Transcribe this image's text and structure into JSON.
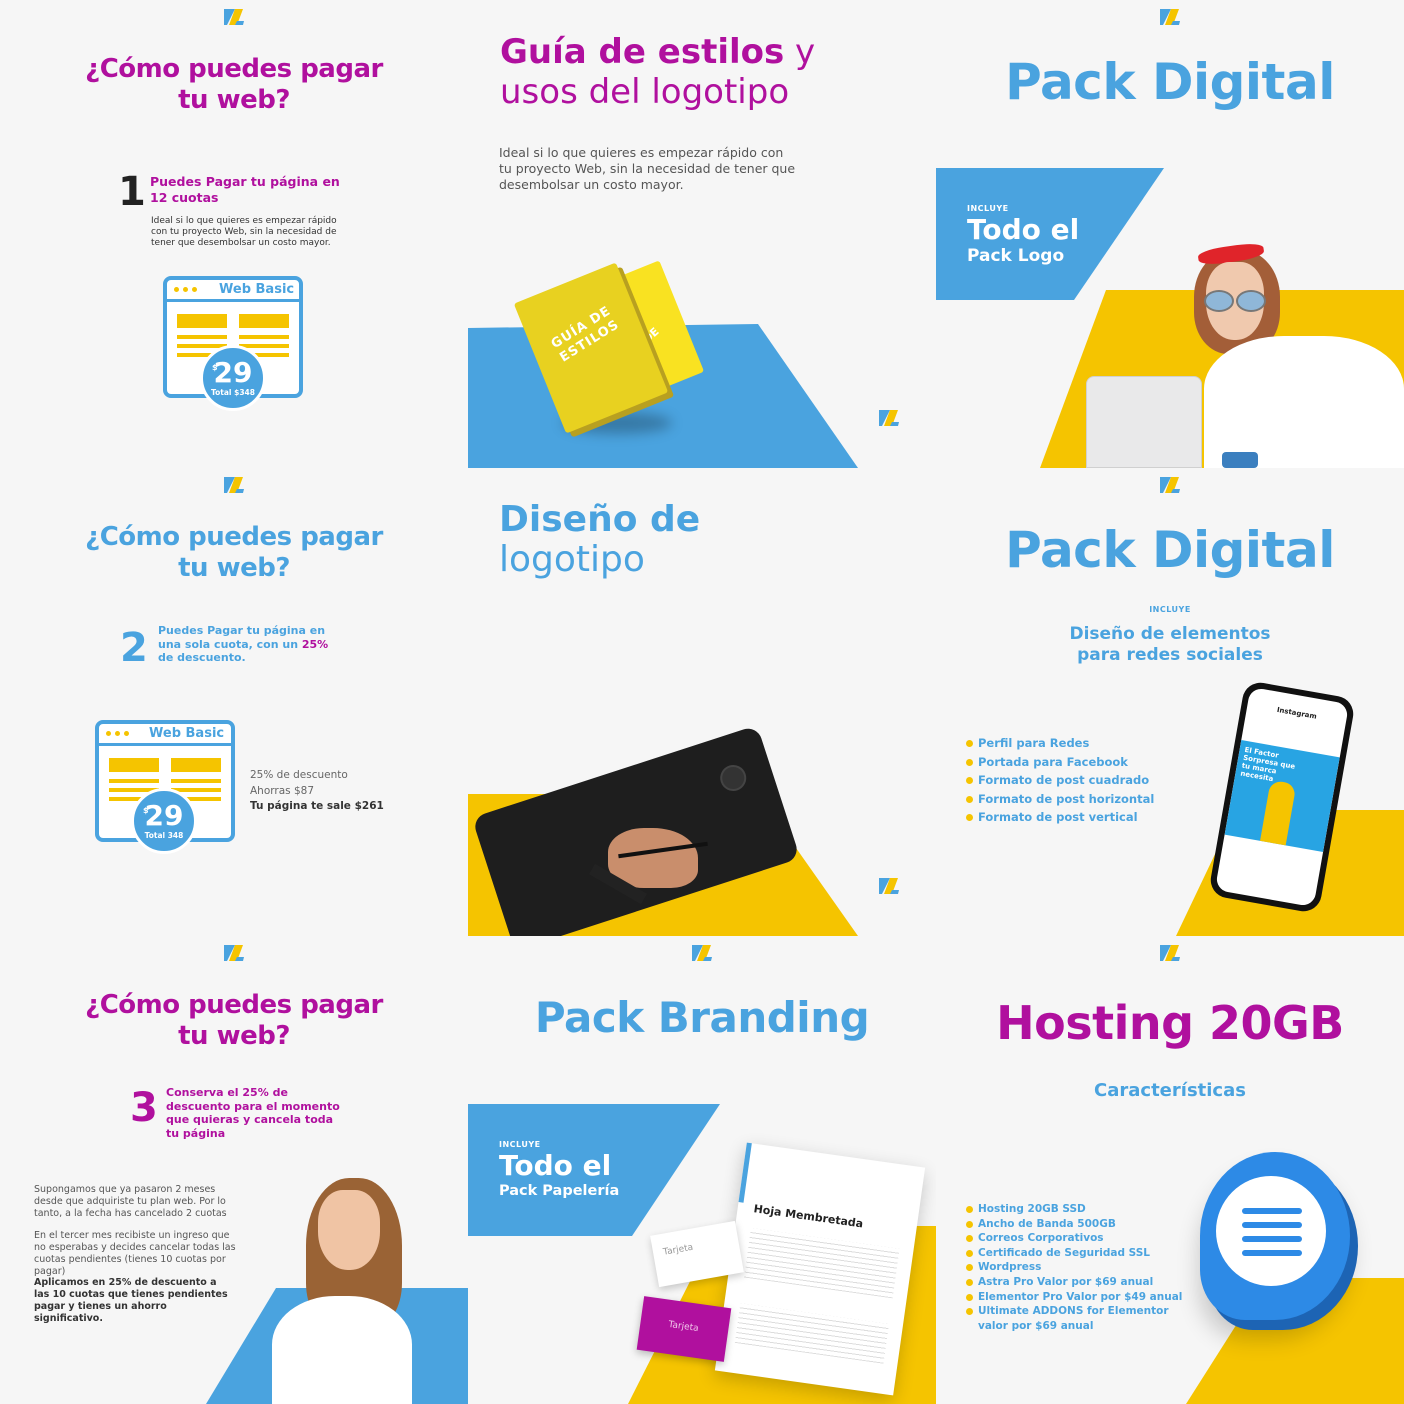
{
  "colors": {
    "magenta": "#b0109e",
    "blue": "#4aa3df",
    "yellow": "#f5c400",
    "bg": "#f6f6f6"
  },
  "logo_icon": "zl-logo-icon",
  "tile1": {
    "title": "¿Cómo puedes pagar tu web?",
    "step_number": "1",
    "step_text": "Puedes Pagar tu página en 12 cuotas",
    "description": "Ideal si lo que quieres es empezar rápido con tu proyecto Web, sin la necesidad de tener que desembolsar un costo mayor.",
    "card_title": "Web Basic",
    "price_currency": "$",
    "price": "29",
    "price_total": "Total $348"
  },
  "tile2": {
    "title_bold": "Guía de estilos",
    "title_rest_1": " y",
    "title_line2": "usos del logotipo",
    "description": "Ideal si lo que quieres es empezar rápido con tu proyecto Web, sin la necesidad de tener que desembolsar un costo mayor.",
    "book_text": "GUÍA DE ESTILOS",
    "book_back_text": "DE"
  },
  "tile3": {
    "title": "Pack Digital",
    "includes_label": "INCLUYE",
    "includes_title": "Todo el",
    "includes_sub": "Pack Logo"
  },
  "tile4": {
    "title": "¿Cómo puedes pagar tu web?",
    "step_number": "2",
    "step_text_a": "Puedes Pagar tu página en una sola cuota, con un ",
    "step_text_bold": "25%",
    "step_text_b": " de descuento.",
    "card_title": "Web Basic",
    "price_currency": "$",
    "price": "29",
    "price_total": "Total 348",
    "discount_line1": "25% de descuento",
    "discount_line2": "Ahorras $87",
    "discount_line3": "Tu página te sale $261"
  },
  "tile5": {
    "title_line1": "Diseño de",
    "title_line2": "logotipo"
  },
  "tile6": {
    "title": "Pack Digital",
    "includes_label": "INCLUYE",
    "subtitle": "Diseño de elementos para redes sociales",
    "items": [
      "Perfil para Redes",
      "Portada para Facebook",
      "Formato de post cuadrado",
      "Formato de post horizontal",
      "Formato de post vertical"
    ],
    "phone_app": "Instagram",
    "phone_post": "El Factor Sorpresa que tu marca necesita"
  },
  "tile7": {
    "title": "¿Cómo puedes pagar tu web?",
    "step_number": "3",
    "step_text_a": "Conserva el ",
    "step_text_bold": "25%",
    "step_text_b": " de descuento para el momento que quieras y cancela toda tu página",
    "para1": "Supongamos que ya pasaron 2 meses desde que adquiriste tu plan web. Por lo tanto, a la fecha has cancelado 2 cuotas",
    "para2": "En el tercer mes recibiste un ingreso que no esperabas y decides cancelar todas las cuotas pendientes (tienes 10 cuotas por pagar)",
    "para3": "Aplicamos en 25% de descuento a las 10 cuotas que tienes pendientes pagar y tienes un ahorro significativo."
  },
  "tile8": {
    "title": "Pack Branding",
    "includes_label": "INCLUYE",
    "includes_title": "Todo el",
    "includes_sub": "Pack Papelería",
    "letterhead": "Hoja Membretada",
    "card_label_1": "Tarjeta",
    "card_label_2": "Tarjeta"
  },
  "tile9": {
    "title": "Hosting 20GB",
    "subtitle": "Características",
    "items": [
      "Hosting 20GB SSD",
      "Ancho de Banda 500GB",
      "Correos Corporativos",
      "Certificado de Seguridad SSL",
      "Wordpress",
      "Astra Pro Valor por $69 anual",
      "Elementor Pro Valor  por $49 anual",
      "Ultimate ADDONS for Elementor",
      "valor por $69 anual"
    ]
  }
}
